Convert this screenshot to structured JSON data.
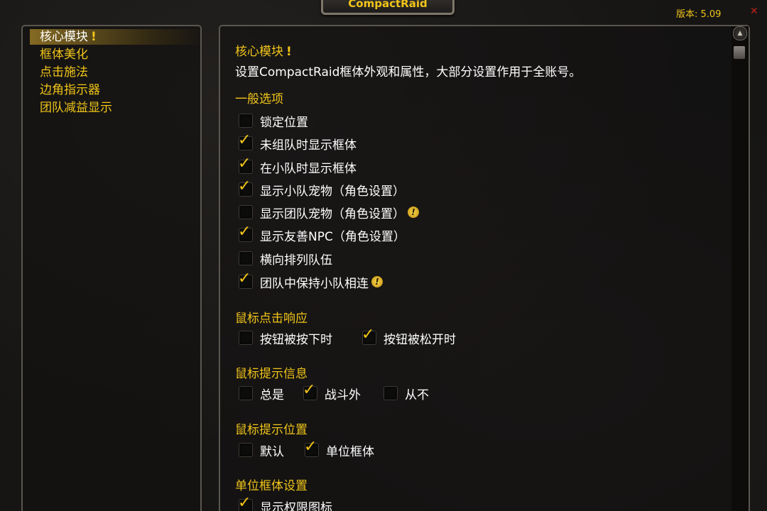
{
  "window": {
    "title": "CompactRaid",
    "version": "版本: 5.09",
    "close_glyph": "✕"
  },
  "sidebar": {
    "items": [
      {
        "label": "核心模块",
        "warn": "!"
      },
      {
        "label": "框体美化"
      },
      {
        "label": "点击施法"
      },
      {
        "label": "边角指示器"
      },
      {
        "label": "团队减益显示"
      }
    ]
  },
  "main": {
    "title": "核心模块",
    "title_warn": "!",
    "description": "设置CompactRaid框体外观和属性，大部分设置作用于全账号。",
    "sections": {
      "general": {
        "title": "一般选项",
        "options": [
          {
            "label": "锁定位置",
            "checked": false
          },
          {
            "label": "未组队时显示框体",
            "checked": true
          },
          {
            "label": "在小队时显示框体",
            "checked": true
          },
          {
            "label": "显示小队宠物（角色设置）",
            "checked": true
          },
          {
            "label": "显示团队宠物（角色设置）",
            "checked": false,
            "info": "!"
          },
          {
            "label": "显示友善NPC（角色设置）",
            "checked": true
          },
          {
            "label": "横向排列队伍",
            "checked": false
          },
          {
            "label": "团队中保持小队相连",
            "checked": true,
            "info": "!"
          }
        ]
      },
      "mouse_click": {
        "title": "鼠标点击响应",
        "options": [
          {
            "label": "按钮被按下时",
            "checked": false
          },
          {
            "label": "按钮被松开时",
            "checked": true
          }
        ]
      },
      "tooltip_info": {
        "title": "鼠标提示信息",
        "options": [
          {
            "label": "总是",
            "checked": false
          },
          {
            "label": "战斗外",
            "checked": true
          },
          {
            "label": "从不",
            "checked": false
          }
        ]
      },
      "tooltip_position": {
        "title": "鼠标提示位置",
        "options": [
          {
            "label": "默认",
            "checked": false
          },
          {
            "label": "单位框体",
            "checked": true
          }
        ]
      },
      "unit_frame": {
        "title": "单位框体设置",
        "options": [
          {
            "label": "显示权限图标",
            "checked": true
          }
        ]
      }
    }
  },
  "scrollbar": {
    "up_glyph": "▲"
  },
  "check_glyph": "✓",
  "colors": {
    "gold": "#f0c419",
    "close": "#c02018",
    "text": "#ffffff"
  }
}
